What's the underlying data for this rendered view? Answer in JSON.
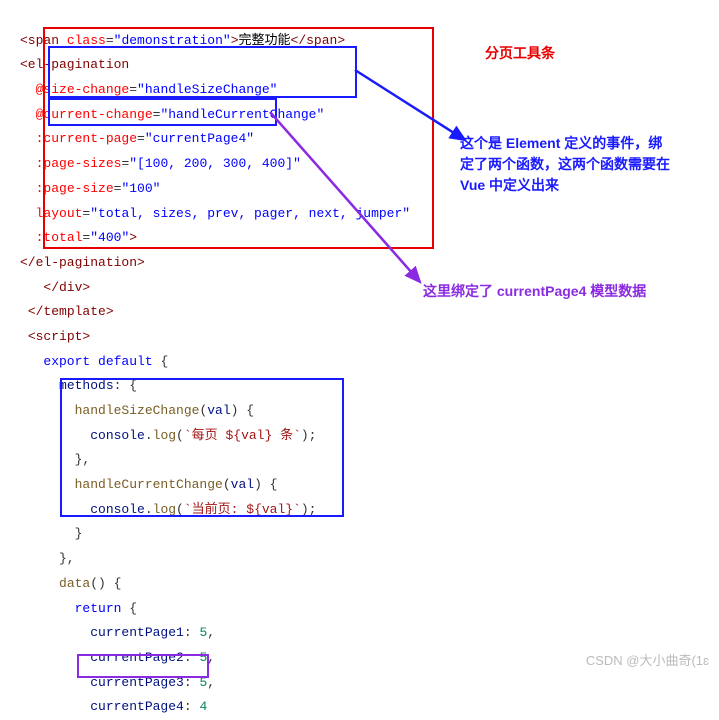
{
  "code": {
    "span_open": "<span",
    "class_attr": "class",
    "class_val": "\"demonstration\"",
    "span_text": "完整功能",
    "span_close": "</span>",
    "el_pag_open": "<el-pagination",
    "at_size": "@size-change",
    "at_size_val": "\"handleSizeChange\"",
    "at_cur": "@current-change",
    "at_cur_val": "\"handleCurrentChange\"",
    "curpage": ":current-page",
    "curpage_val": "\"currentPage4\"",
    "pagesizes": ":page-sizes",
    "pagesizes_val": "\"[100, 200, 300, 400]\"",
    "pagesize": ":page-size",
    "pagesize_val": "\"100\"",
    "layout": "layout",
    "layout_val": "\"total, sizes, prev, pager, next, jumper\"",
    "total": ":total",
    "total_val": "\"400\"",
    "el_pag_close": "</el-pagination>",
    "div_close": "</div>",
    "tmpl_close": "</template>",
    "script_open": "<script>",
    "export": "export",
    "default": "default",
    "methods": "methods",
    "hsc": "handleSizeChange",
    "val": "val",
    "console": "console",
    "log": "log",
    "perpage_tmpl": "`每页 ${val} 条`",
    "hcc": "handleCurrentChange",
    "curpage_tmpl": "`当前页: ${val}`",
    "data": "data",
    "return": "return",
    "cp1": "currentPage1",
    "cp2": "currentPage2",
    "cp3": "currentPage3",
    "cp4": "currentPage4",
    "n5": "5",
    "n4": "4"
  },
  "annot": {
    "title": "分页工具条",
    "blue": "这个是 Element 定义的事件，绑定了两个函数，这两个函数需要在 Vue 中定义出来",
    "purple": "这里绑定了 currentPage4 模型数据"
  },
  "watermark": "CSDN @大小曲奇(1ɛ"
}
